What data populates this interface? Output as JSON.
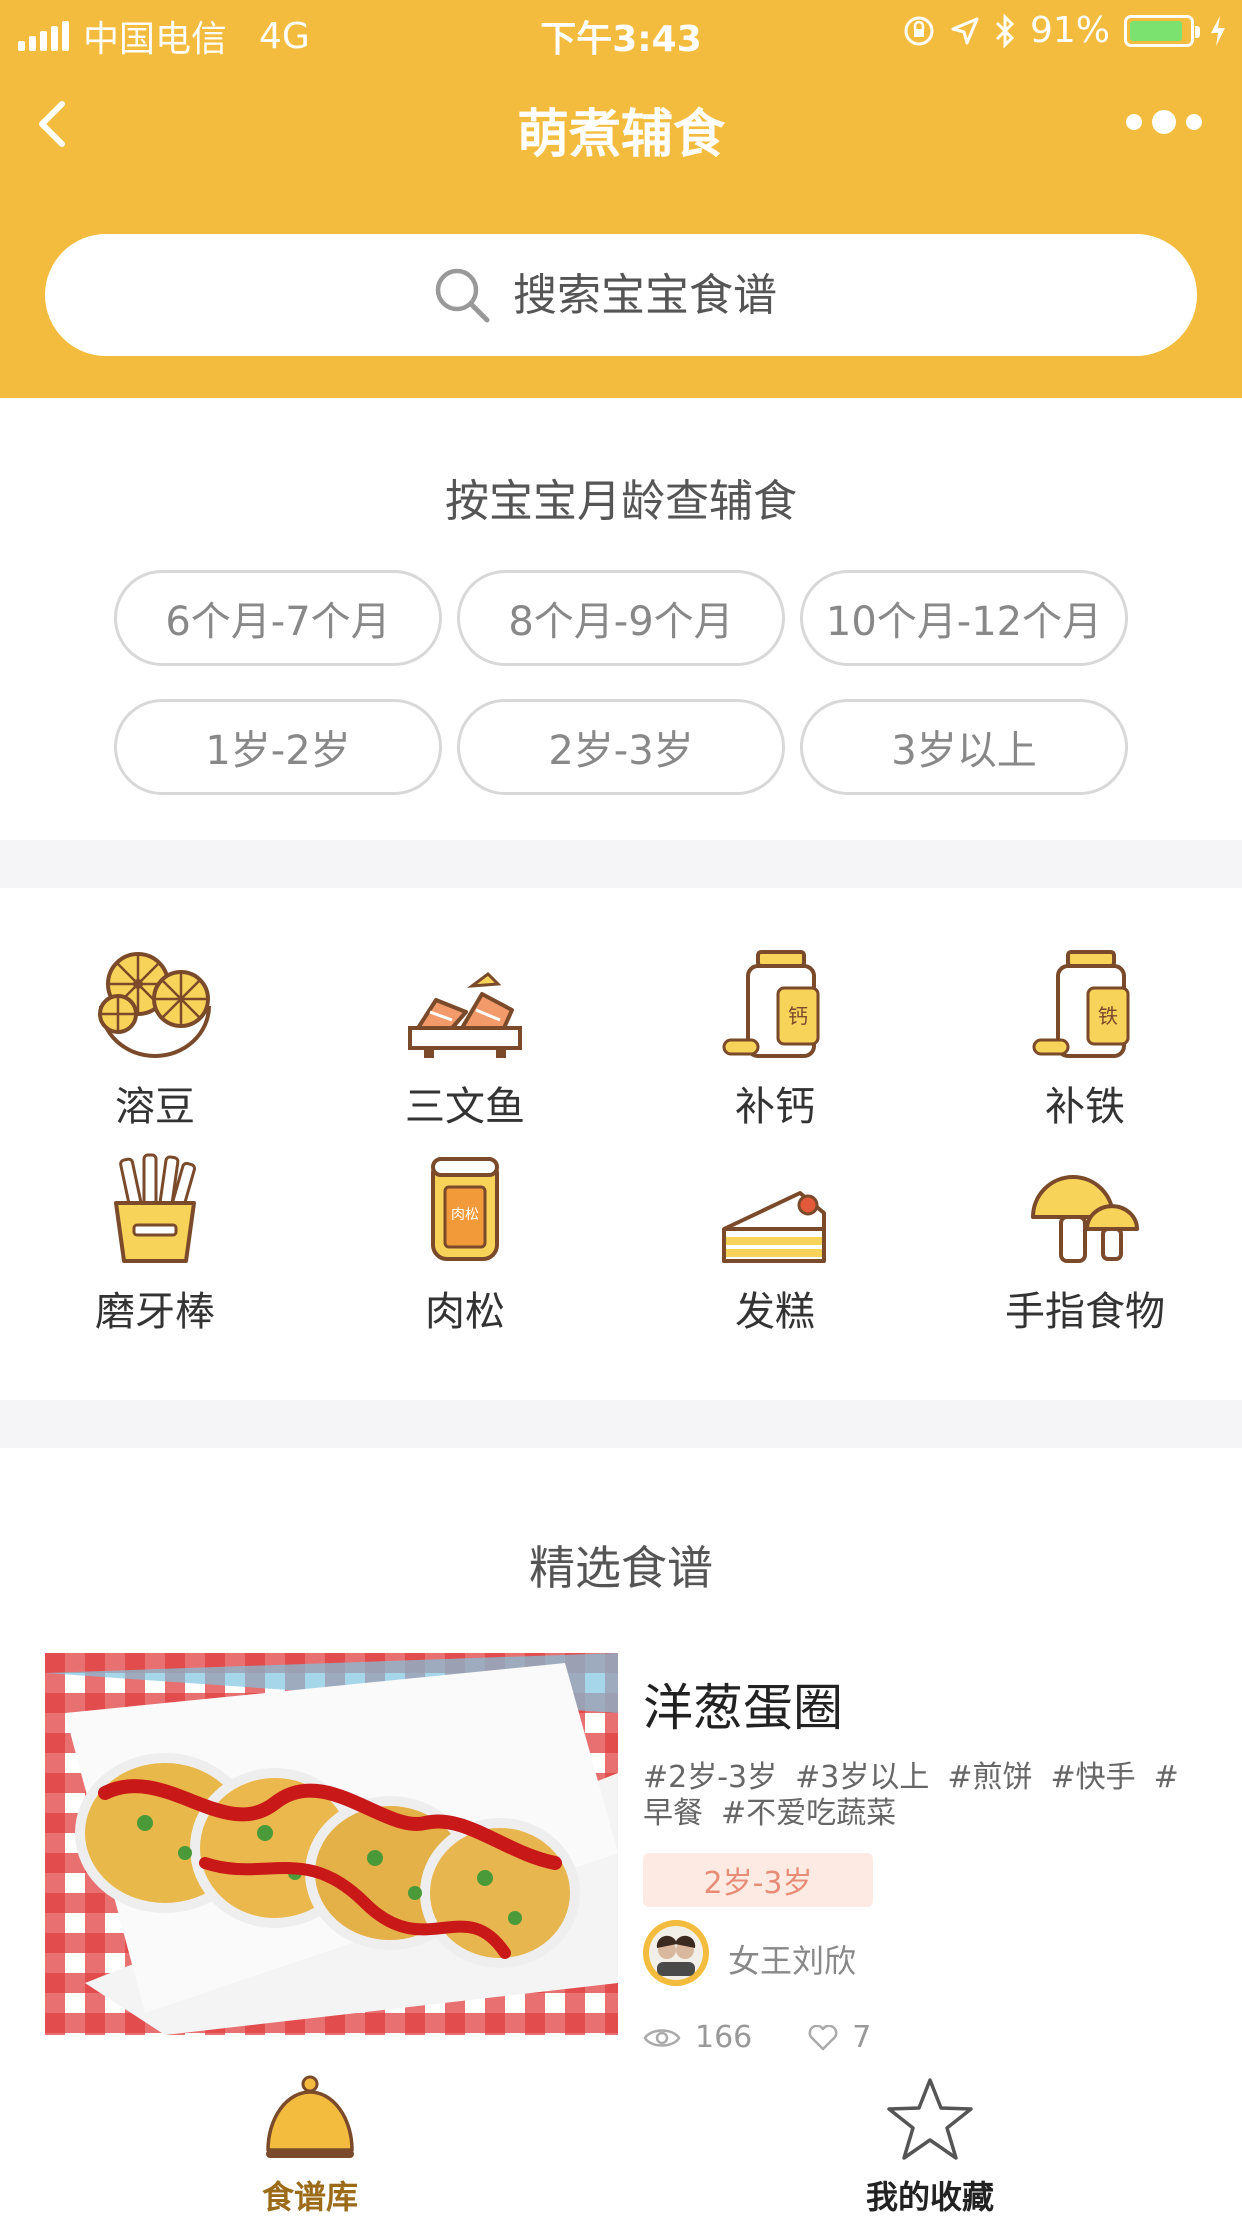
{
  "status_bar": {
    "carrier": "中国电信",
    "network": "4G",
    "time": "下午3:43",
    "battery_percent": "91%",
    "battery_level": 0.91
  },
  "nav": {
    "title": "萌煮辅食",
    "back_icon": "chevron-left-icon",
    "more_icon": "more-dots-icon"
  },
  "search": {
    "placeholder": "搜索宝宝食谱"
  },
  "age_section": {
    "title": "按宝宝月龄查辅食",
    "options": [
      "6个月-7个月",
      "8个月-9个月",
      "10个月-12个月",
      "1岁-2岁",
      "2岁-3岁",
      "3岁以上"
    ]
  },
  "categories": [
    {
      "label": "溶豆",
      "icon": "melting-beans-icon"
    },
    {
      "label": "三文鱼",
      "icon": "salmon-sushi-icon"
    },
    {
      "label": "补钙",
      "icon": "calcium-bottle-icon",
      "badge": "钙"
    },
    {
      "label": "补铁",
      "icon": "iron-bottle-icon",
      "badge": "铁"
    },
    {
      "label": "磨牙棒",
      "icon": "teething-sticks-icon"
    },
    {
      "label": "肉松",
      "icon": "meat-floss-jar-icon",
      "badge": "肉松"
    },
    {
      "label": "发糕",
      "icon": "cake-icon"
    },
    {
      "label": "手指食物",
      "icon": "mushroom-icon"
    }
  ],
  "featured": {
    "title": "精选食谱",
    "recipe": {
      "name": "洋葱蛋圈",
      "tags": [
        "#2岁-3岁",
        "#3岁以上",
        "#煎饼",
        "#快手",
        "#早餐",
        "#不爱吃蔬菜"
      ],
      "age_badge": "2岁-3岁",
      "author": "女王刘欣",
      "views": "166",
      "likes": "7"
    }
  },
  "tab_bar": {
    "tabs": [
      {
        "label": "食谱库",
        "icon": "cloche-icon",
        "active": true
      },
      {
        "label": "我的收藏",
        "icon": "star-icon",
        "active": false
      }
    ]
  },
  "colors": {
    "brand": "#F4BC3E",
    "accent_text": "#9C6B1A",
    "badge_bg": "#FDEAE2",
    "badge_text": "#E78C76"
  }
}
